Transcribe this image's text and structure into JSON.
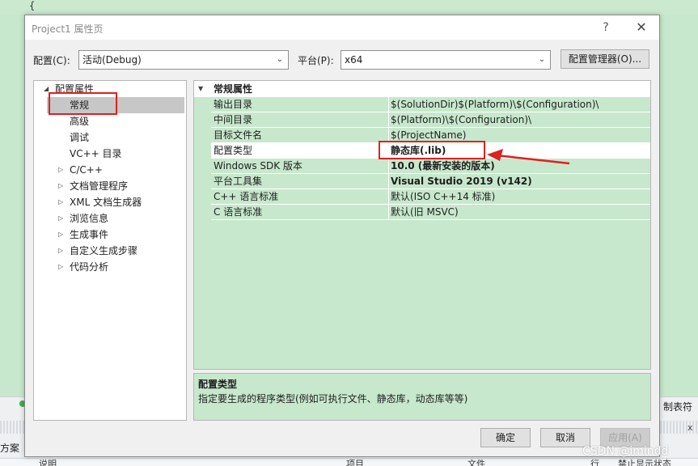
{
  "background": {
    "brace": "{",
    "status_right": "制表符",
    "panel_label": "方案",
    "close_x": "x",
    "columns": [
      "说明",
      "项目",
      "文件",
      "行",
      "禁止显示状态"
    ]
  },
  "dialog": {
    "title": "Project1 属性页",
    "help": "?",
    "close": "✕",
    "config_label": "配置(C):",
    "config_value": "活动(Debug)",
    "platform_label": "平台(P):",
    "platform_value": "x64",
    "config_manager": "配置管理器(O)..."
  },
  "tree": {
    "root": "配置属性",
    "items": [
      {
        "label": "常规",
        "expandable": false,
        "selected": true
      },
      {
        "label": "高级",
        "expandable": false
      },
      {
        "label": "调试",
        "expandable": false
      },
      {
        "label": "VC++ 目录",
        "expandable": false
      },
      {
        "label": "C/C++",
        "expandable": true
      },
      {
        "label": "文档管理程序",
        "expandable": true
      },
      {
        "label": "XML 文档生成器",
        "expandable": true
      },
      {
        "label": "浏览信息",
        "expandable": true
      },
      {
        "label": "生成事件",
        "expandable": true
      },
      {
        "label": "自定义生成步骤",
        "expandable": true
      },
      {
        "label": "代码分析",
        "expandable": true
      }
    ]
  },
  "grid": {
    "section": "常规属性",
    "rows": [
      {
        "key": "输出目录",
        "value": "$(SolutionDir)$(Platform)\\$(Configuration)\\",
        "bold": false
      },
      {
        "key": "中间目录",
        "value": "$(Platform)\\$(Configuration)\\",
        "bold": false
      },
      {
        "key": "目标文件名",
        "value": "$(ProjectName)",
        "bold": false
      },
      {
        "key": "配置类型",
        "value": "静态库(.lib)",
        "bold": true
      },
      {
        "key": "Windows SDK 版本",
        "value": "10.0 (最新安装的版本)",
        "bold": true
      },
      {
        "key": "平台工具集",
        "value": "Visual Studio 2019 (v142)",
        "bold": true
      },
      {
        "key": "C++ 语言标准",
        "value": "默认(ISO C++14 标准)",
        "bold": false
      },
      {
        "key": "C 语言标准",
        "value": "默认(旧 MSVC)",
        "bold": false
      }
    ]
  },
  "description": {
    "title": "配置类型",
    "text": "指定要生成的程序类型(例如可执行文件、静态库，动态库等等)"
  },
  "buttons": {
    "ok": "确定",
    "cancel": "取消",
    "apply": "应用(A)"
  },
  "watermark": "CSDN @imindd",
  "colors": {
    "grid_bg": "#c7e8cc",
    "annotation": "#e02020",
    "selection": "#c7c7c7"
  }
}
